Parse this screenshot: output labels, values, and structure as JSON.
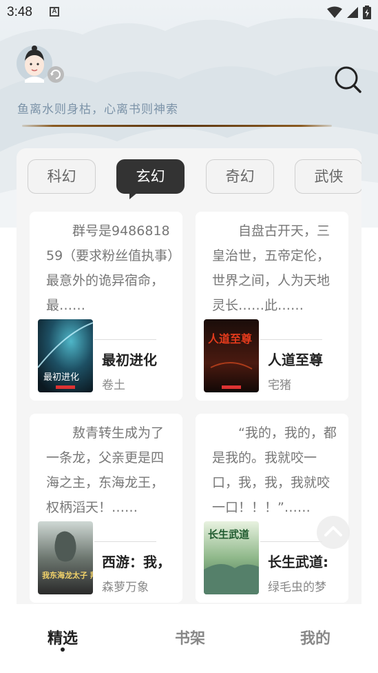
{
  "status_bar": {
    "time": "3:48",
    "notification_letter": "A"
  },
  "header": {
    "motto": "鱼离水则身枯，心离书则神索"
  },
  "tabs": [
    {
      "label": "科幻",
      "active": false
    },
    {
      "label": "玄幻",
      "active": true
    },
    {
      "label": "奇幻",
      "active": false
    },
    {
      "label": "武侠",
      "active": false
    }
  ],
  "books": [
    {
      "desc": "群号是948681859（要求粉丝值执事）最意外的诡异宿命，最……",
      "title": "最初进化",
      "author": "卷土",
      "cover_text": "最初进化"
    },
    {
      "desc": "自盘古开天，三皇治世，五帝定伦，世界之间，人为天地灵长……此……",
      "title": "人道至尊",
      "author": "宅猪",
      "cover_text": "人道至尊"
    },
    {
      "desc": "敖青转生成为了一条龙，父亲更是四海之主，东海龙王，权柄滔天！……",
      "title": "西游：我，",
      "author": "森萝万象",
      "cover_text": "我东海龙太子 拜师菩提"
    },
    {
      "desc": "“我的，我的，都是我的。我就咬一口，我，我，我就咬一口！！！”……",
      "title": "长生武道:",
      "author": "绿毛虫的梦",
      "cover_text": "长生武道"
    }
  ],
  "bottom_nav": [
    {
      "label": "精选",
      "active": true
    },
    {
      "label": "书架",
      "active": false
    },
    {
      "label": "我的",
      "active": false
    }
  ],
  "colors": {
    "accent_dark": "#333333",
    "motto": "#7c93a8",
    "panel_bg": "#f5f5f5"
  }
}
